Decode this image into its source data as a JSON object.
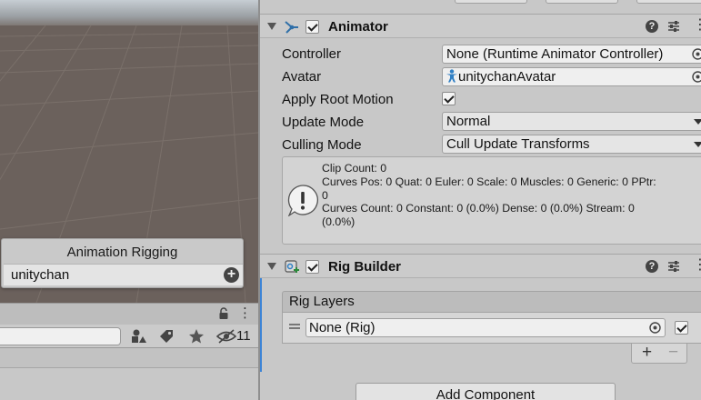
{
  "colors": {
    "scene_ground": "#6b615c",
    "scene_sky": "#c6cdd3",
    "inspector_bg": "#c8c8c8",
    "selection_accent": "#3d84d6"
  },
  "scene_overlay": {
    "title": "Animation Rigging",
    "row_label": "unitychan",
    "add_icon": "plus-circle-icon"
  },
  "project_panel": {
    "search_value": "",
    "hidden_count": "11",
    "icons": [
      "lock-icon",
      "kebab-icon",
      "filter-type-icon",
      "label-tag-icon",
      "favorite-star-icon",
      "hidden-eye-icon"
    ]
  },
  "animator": {
    "title": "Animator",
    "enabled": true,
    "controller_label": "Controller",
    "controller_value": "None (Runtime Animator Controller)",
    "avatar_label": "Avatar",
    "avatar_value": "unitychanAvatar",
    "apply_root_motion_label": "Apply Root Motion",
    "apply_root_motion": true,
    "update_mode_label": "Update Mode",
    "update_mode_value": "Normal",
    "culling_mode_label": "Culling Mode",
    "culling_mode_value": "Cull Update Transforms",
    "info": {
      "line1": "Clip Count: 0",
      "line2": "Curves Pos: 0 Quat: 0 Euler: 0 Scale: 0 Muscles: 0 Generic: 0 PPtr:",
      "line3": "0",
      "line4": "Curves Count: 0 Constant: 0 (0.0%) Dense: 0 (0.0%) Stream: 0",
      "line5": "(0.0%)"
    }
  },
  "rig_builder": {
    "title": "Rig Builder",
    "enabled": true,
    "rig_layers_label": "Rig Layers",
    "layer_value": "None (Rig)",
    "layer_active": true,
    "plus_label": "+",
    "minus_label": "−"
  },
  "add_component_label": "Add Component"
}
